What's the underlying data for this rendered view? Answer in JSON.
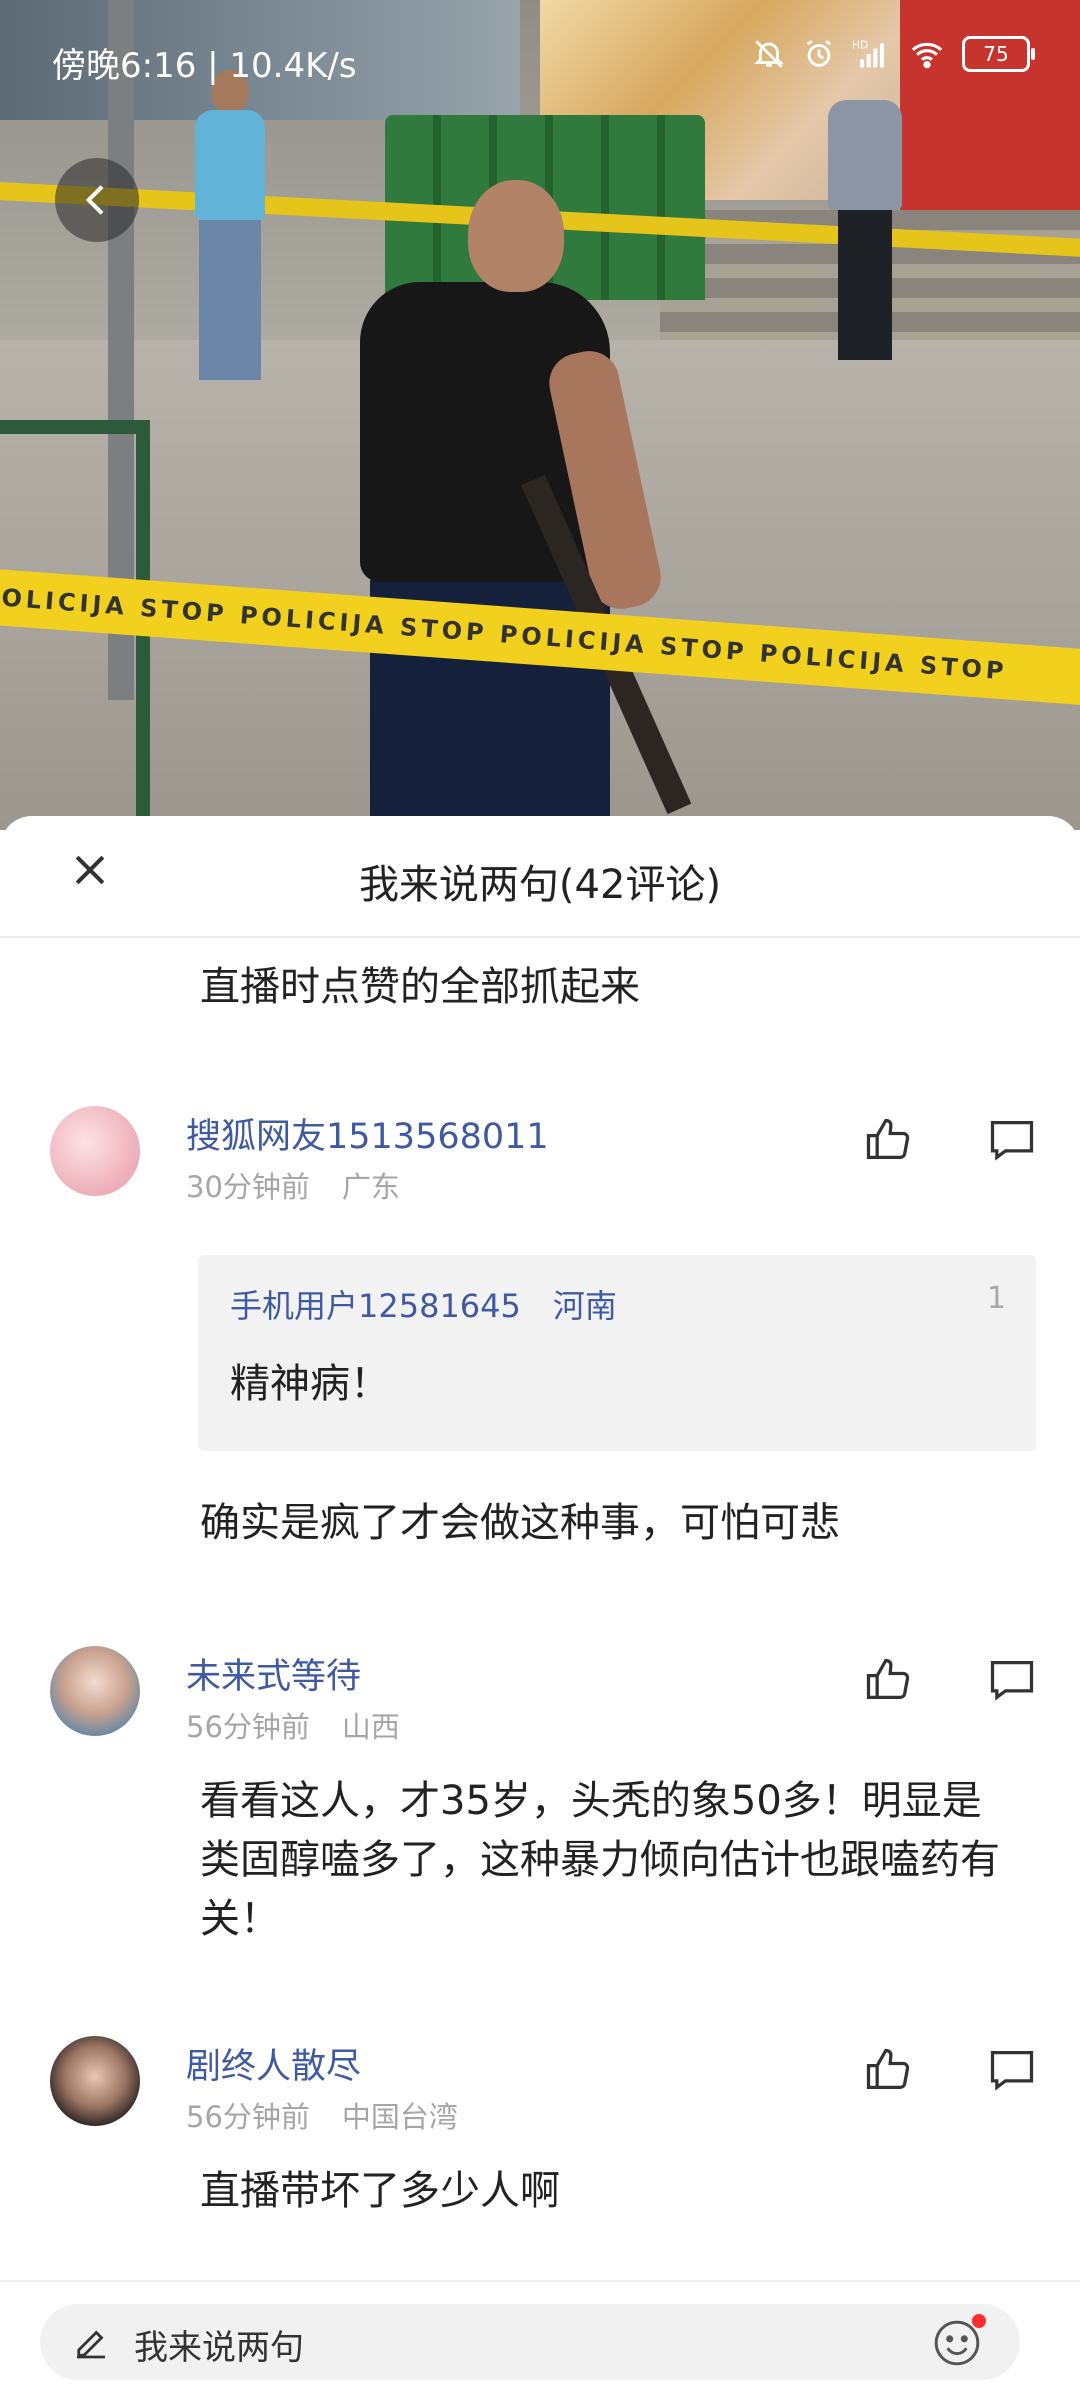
{
  "status_bar": {
    "time_speed": "傍晚6:16 | 10.4K/s",
    "battery": "75",
    "icons": [
      "mute-bell-icon",
      "alarm-icon",
      "hd-signal-icon",
      "wifi-icon",
      "battery-icon"
    ]
  },
  "photo": {
    "tape_text": "POLICIJA STOP    POLICIJA STOP    POLICIJA STOP    POLICIJA STOP"
  },
  "sheet": {
    "title": "我来说两句(42评论)"
  },
  "comments": [
    {
      "text": "直播时点赞的全部抓起来"
    },
    {
      "user": "搜狐网友1513568011",
      "time": "30分钟前",
      "location": "广东",
      "reply": {
        "user": "手机用户12581645",
        "location": "河南",
        "count": "1",
        "text": "精神病！"
      },
      "text": "确实是疯了才会做这种事，可怕可悲"
    },
    {
      "user": "未来式等待",
      "time": "56分钟前",
      "location": "山西",
      "text": "看看这人，才35岁，头秃的象50多！明显是类固醇嗑多了，这种暴力倾向估计也跟嗑药有关！"
    },
    {
      "user": "剧终人散尽",
      "time": "56分钟前",
      "location": "中国台湾",
      "text": "直播带坏了多少人啊"
    }
  ],
  "input_bar": {
    "placeholder": "我来说两句"
  },
  "colors": {
    "username": "#3f5aa0",
    "meta": "#a6a6a6",
    "reply_bg": "#f2f2f2",
    "notify_dot": "#ff2d2d"
  }
}
